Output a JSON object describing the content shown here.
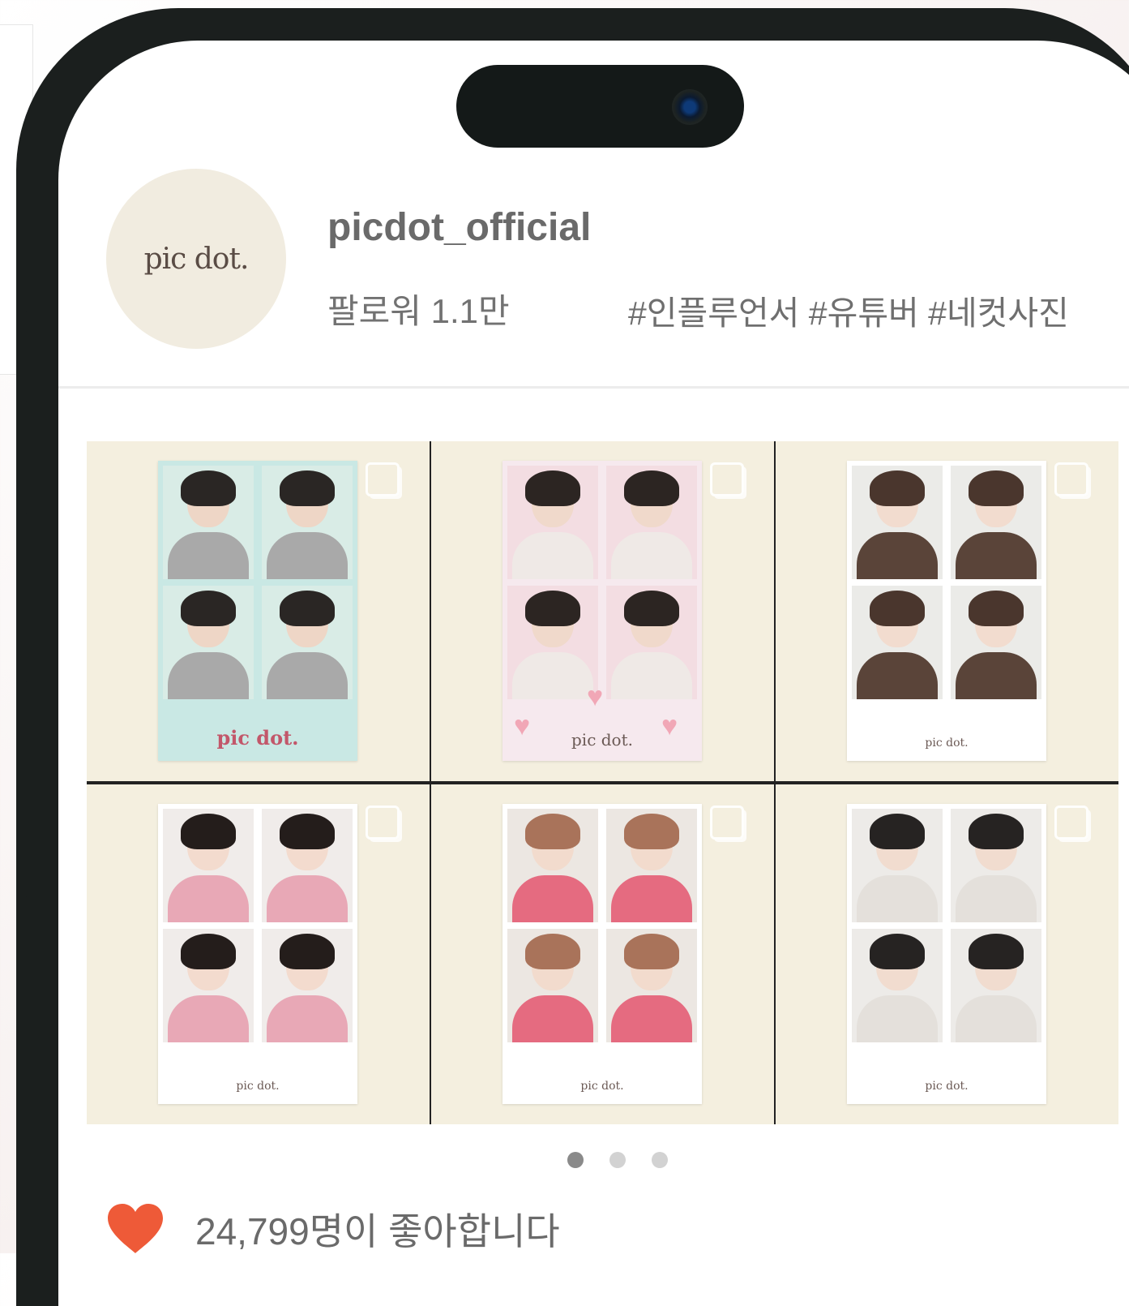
{
  "profile": {
    "avatar_text": "pic dot.",
    "username": "picdot_official",
    "followers": "팔로워 1.1만",
    "hashtags": "#인플루언서 #유튜버 #네컷사진"
  },
  "post": {
    "tiles": [
      {
        "style": "teal",
        "logo": "pic dot."
      },
      {
        "style": "pinkish",
        "logo": "pic dot."
      },
      {
        "style": "white",
        "logo": "pic dot."
      },
      {
        "style": "white",
        "logo": "pic dot."
      },
      {
        "style": "white",
        "logo": "pic dot."
      },
      {
        "style": "white",
        "logo": "pic dot."
      }
    ],
    "carousel": {
      "total": 3,
      "active": 1
    },
    "likes_text": "24,799명이 좋아합니다"
  },
  "colors": {
    "heart": "#ee5a38",
    "tile_background": "#f4efdf",
    "avatar_background": "#f1ece0"
  },
  "icons": [
    "heart-icon",
    "multi-photo-icon",
    "camera-icon"
  ]
}
